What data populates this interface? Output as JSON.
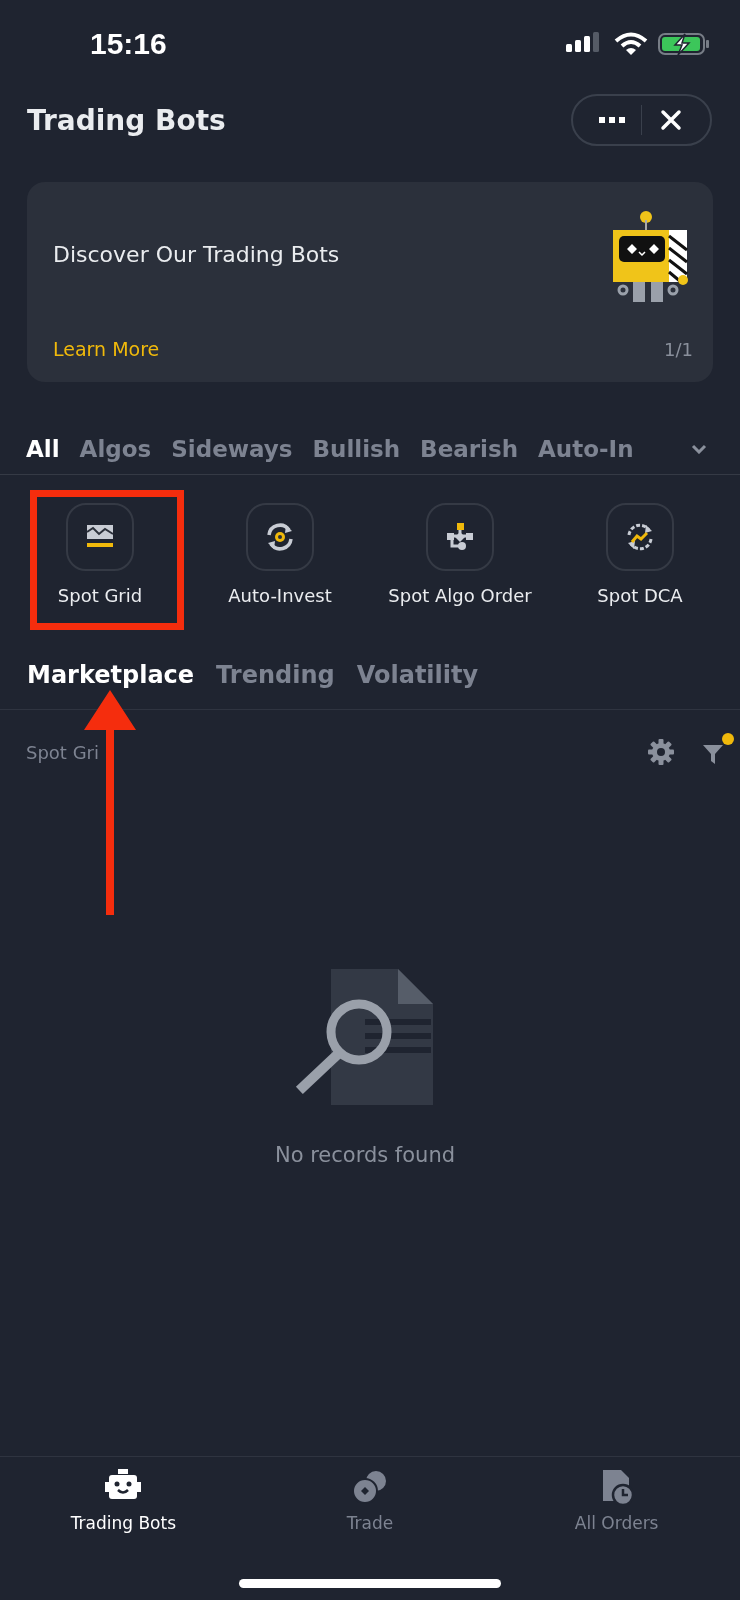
{
  "status_bar": {
    "time": "15:16"
  },
  "header": {
    "title": "Trading Bots"
  },
  "banner": {
    "title": "Discover Our Trading Bots",
    "link": "Learn More",
    "pager": "1/1"
  },
  "category_tabs": [
    {
      "label": "All",
      "selected": true
    },
    {
      "label": "Algos",
      "selected": false
    },
    {
      "label": "Sideways",
      "selected": false
    },
    {
      "label": "Bullish",
      "selected": false
    },
    {
      "label": "Bearish",
      "selected": false
    },
    {
      "label": "Auto-In",
      "selected": false
    }
  ],
  "bots": [
    {
      "kind": "grid",
      "label": "Spot Grid",
      "highlighted": true
    },
    {
      "kind": "invest",
      "label": "Auto-Invest",
      "highlighted": false
    },
    {
      "kind": "algo",
      "label": "Spot Algo Order",
      "highlighted": false
    },
    {
      "kind": "dca",
      "label": "Spot DCA",
      "highlighted": false
    }
  ],
  "market_tabs": [
    {
      "label": "Marketplace",
      "selected": true
    },
    {
      "label": "Trending",
      "selected": false
    },
    {
      "label": "Volatility",
      "selected": false
    }
  ],
  "filter_row": {
    "label": "Spot Gri",
    "filter_active": true
  },
  "empty_state": {
    "message": "No records found"
  },
  "bottom_nav": [
    {
      "kind": "bots",
      "label": "Trading Bots",
      "selected": true
    },
    {
      "kind": "trade",
      "label": "Trade",
      "selected": false
    },
    {
      "kind": "orders",
      "label": "All Orders",
      "selected": false
    }
  ]
}
